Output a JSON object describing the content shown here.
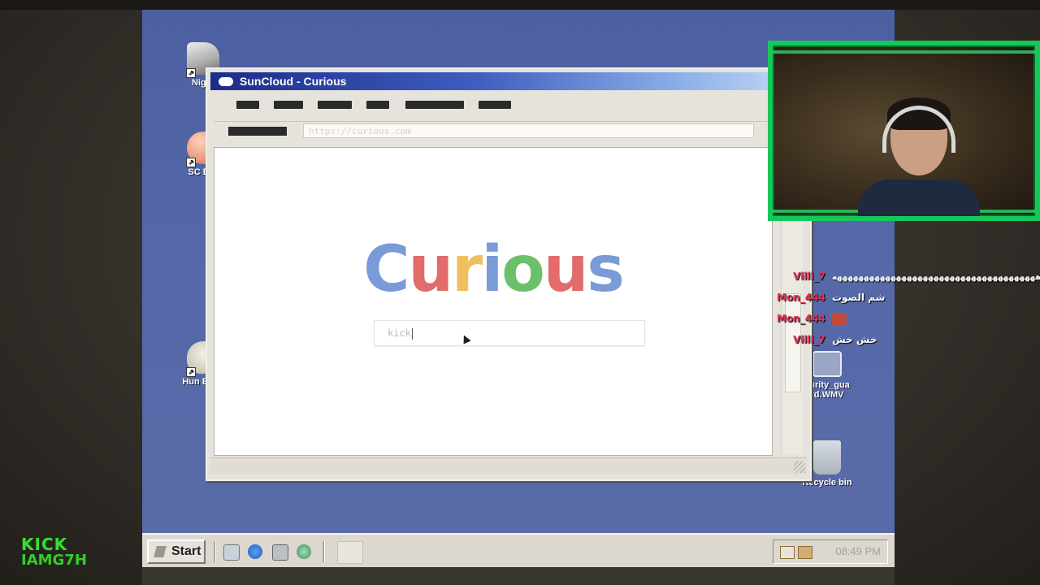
{
  "window": {
    "title": "SunCloud - Curious",
    "close": "×"
  },
  "address_bar": {
    "url": "https://curious.com"
  },
  "page": {
    "logo": [
      "C",
      "u",
      "r",
      "i",
      "o",
      "u",
      "s"
    ],
    "logo_colors": [
      "#7a9ad8",
      "#e26b6b",
      "#f0c060",
      "#7a9ad8",
      "#6cc06c",
      "#e26b6b",
      "#7a9ad8"
    ],
    "search_value": "kick"
  },
  "desktop_icons": [
    {
      "label": "Night",
      "icon": "security-camera-icon"
    },
    {
      "label": "SC Bro",
      "icon": "browser-icon"
    },
    {
      "label": "Hun Baby",
      "icon": "baby-monitor-icon"
    },
    {
      "label": "curity_gua rd.WMV",
      "icon": "video-file-icon"
    },
    {
      "label": "Recycle bin",
      "icon": "recycle-bin-icon"
    }
  ],
  "taskbar": {
    "start_label": "Start",
    "clock": "08:49 PM"
  },
  "chat": [
    {
      "user": "Villl_7",
      "message": "ههههههههههههههههههههههههههههههههههههههه"
    },
    {
      "user": "Mon_444",
      "message": "شم الصوت"
    },
    {
      "user": "Mon_444",
      "message": ""
    },
    {
      "user": "Villl_7",
      "message": "خش خش"
    }
  ],
  "overlay": {
    "brand": "KICK",
    "channel": "IAMG7H"
  },
  "colors": {
    "accent": "#16c85a",
    "chat_user": "#e0355a",
    "desktop": "#5467a8"
  }
}
